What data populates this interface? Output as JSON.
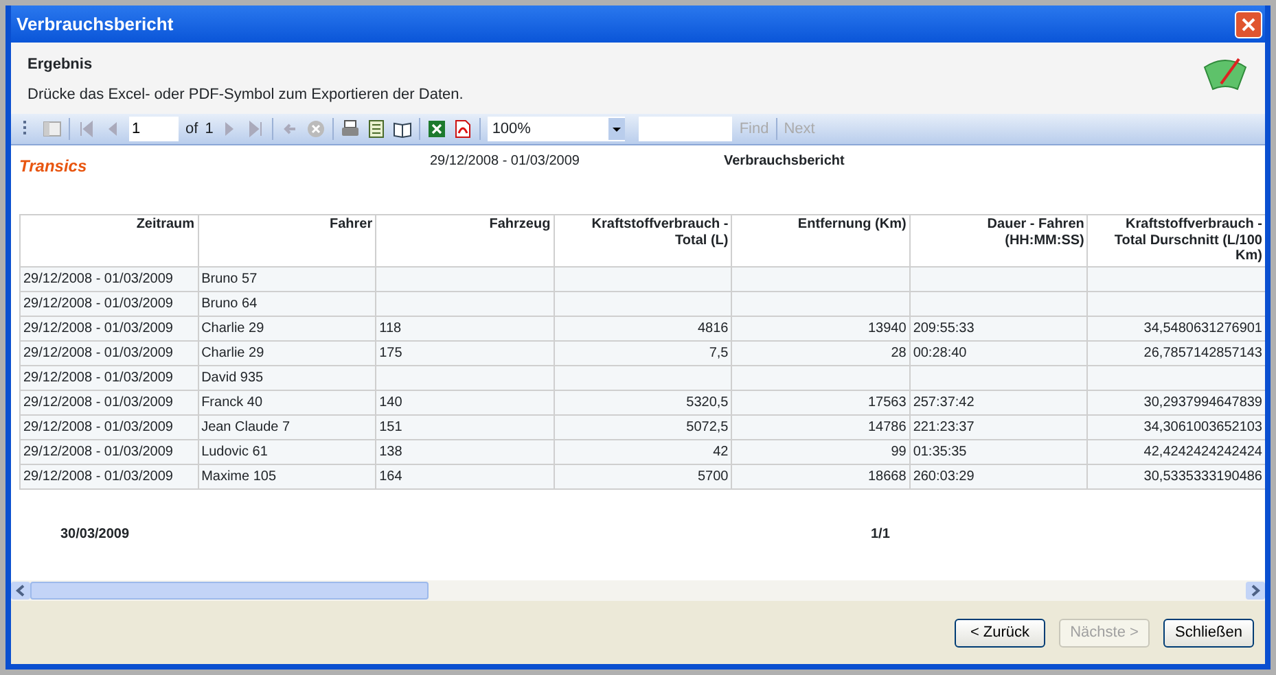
{
  "window": {
    "title": "Verbrauchsbericht"
  },
  "header": {
    "title": "Ergebnis",
    "instructions": "Drücke das Excel- oder PDF-Symbol zum Exportieren der Daten."
  },
  "toolbar": {
    "page": "1",
    "page_of": "of",
    "page_count": "1",
    "zoom": "100%",
    "find": {
      "label": "Find",
      "disabled": true
    },
    "next": {
      "label": "Next",
      "disabled": true
    }
  },
  "report": {
    "brand": "Transics",
    "date_range": "29/12/2008 - 01/03/2009",
    "title": "Verbrauchsbericht",
    "columns": [
      "Zeitraum",
      "Fahrer",
      "Fahrzeug",
      "Kraftstoffverbrauch - Total (L)",
      "Entfernung (Km)",
      "Dauer - Fahren (HH:MM:SS)",
      "Kraftstoffverbrauch - Total Durschnitt (L/100 Km)"
    ],
    "rows": [
      [
        "29/12/2008 - 01/03/2009",
        "Bruno 57",
        null,
        null,
        null,
        null,
        null
      ],
      [
        "29/12/2008 - 01/03/2009",
        "Bruno 64",
        null,
        null,
        null,
        null,
        null
      ],
      [
        "29/12/2008 - 01/03/2009",
        "Charlie 29",
        "118",
        "4816",
        "13940",
        "209:55:33",
        "34,5480631276901"
      ],
      [
        "29/12/2008 - 01/03/2009",
        "Charlie 29",
        "175",
        "7,5",
        "28",
        "00:28:40",
        "26,7857142857143"
      ],
      [
        "29/12/2008 - 01/03/2009",
        "David 935",
        null,
        null,
        null,
        null,
        null
      ],
      [
        "29/12/2008 - 01/03/2009",
        "Franck 40",
        "140",
        "5320,5",
        "17563",
        "257:37:42",
        "30,2937994647839"
      ],
      [
        "29/12/2008 - 01/03/2009",
        "Jean Claude 7",
        "151",
        "5072,5",
        "14786",
        "221:23:37",
        "34,3061003652103"
      ],
      [
        "29/12/2008 - 01/03/2009",
        "Ludovic 61",
        "138",
        "42",
        "99",
        "01:35:35",
        "42,4242424242424"
      ],
      [
        "29/12/2008 - 01/03/2009",
        "Maxime 105",
        "164",
        "5700",
        "18668",
        "260:03:29",
        "30,5335333190486"
      ]
    ],
    "footer_date": "30/03/2009",
    "page_info": "1/1"
  },
  "buttons": [
    {
      "label": "< Zurück",
      "disabled": false
    },
    {
      "label": "Nächste >",
      "disabled": true
    },
    {
      "label": "Schließen",
      "disabled": false
    }
  ]
}
